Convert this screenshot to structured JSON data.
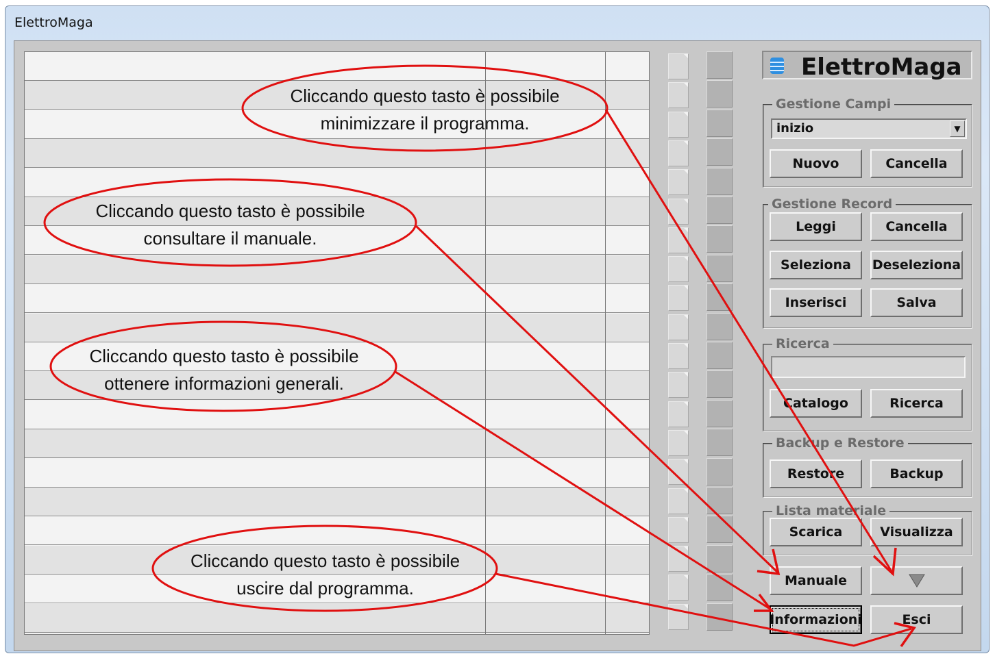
{
  "window": {
    "title": "ElettroMaga"
  },
  "panel": {
    "logo_text": "ElettroMaga",
    "gestione_campi": {
      "label": "Gestione Campi",
      "selected_value": "inizio",
      "nuovo": "Nuovo",
      "cancella": "Cancella"
    },
    "gestione_record": {
      "label": "Gestione Record",
      "leggi": "Leggi",
      "cancella": "Cancella",
      "seleziona": "Seleziona",
      "deseleziona": "Deseleziona",
      "inserisci": "Inserisci",
      "salva": "Salva"
    },
    "ricerca": {
      "label": "Ricerca",
      "search_value": "",
      "catalogo": "Catalogo",
      "ricerca": "Ricerca"
    },
    "backup_restore": {
      "label": "Backup e Restore",
      "restore": "Restore",
      "backup": "Backup"
    },
    "lista_materiale": {
      "label": "Lista materiale",
      "scarica": "Scarica",
      "visualizza": "Visualizza"
    },
    "bottom": {
      "manuale": "Manuale",
      "minimize_icon": "triangle-down-icon",
      "informazioni": "Informazioni",
      "esci": "Esci"
    }
  },
  "annotations": {
    "minimize": [
      "Cliccando questo tasto è possibile",
      "minimizzare il programma."
    ],
    "manual": [
      "Cliccando questo tasto è possibile",
      "consultare il manuale."
    ],
    "info": [
      "Cliccando questo tasto è possibile",
      "ottenere informazioni generali."
    ],
    "exit": [
      "Cliccando questo tasto è possibile",
      "uscire dal programma."
    ]
  },
  "colors": {
    "annotation": "#e01010",
    "panel_bg": "#c8c8c8",
    "row_alt": "#e2e2e2",
    "row_norm": "#f3f3f3"
  }
}
